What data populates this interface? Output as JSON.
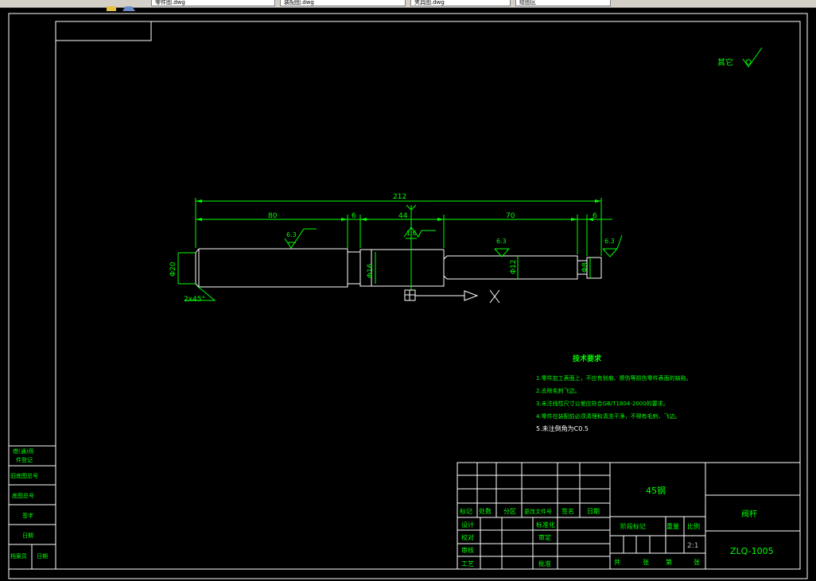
{
  "window": {
    "tabs": [
      {
        "label": "零件图.dwg"
      },
      {
        "label": "装配图.dwg"
      },
      {
        "label": "夹具图.dwg"
      },
      {
        "label": "绘图区"
      }
    ]
  },
  "colors": {
    "background": "#000000",
    "frame": "#ffffff",
    "geometry": "#ffffff",
    "dimension": "#00ff00",
    "text": "#00ff00",
    "ucs": "#ffffff"
  },
  "drawing": {
    "roughness_other": {
      "label": "其它",
      "symbol": "roughness-check-icon"
    },
    "dims": {
      "overall": "212",
      "d80": "80",
      "d6a": "6",
      "d44": "44",
      "d70": "70",
      "d6b": "6",
      "dia20": "Φ20",
      "dia16": "Φ16",
      "dia12": "Φ12",
      "dia8": "Φ8",
      "chamfer": "2x45°"
    },
    "roughness_values": [
      "6.3",
      "1.6",
      "6.3",
      "6.3"
    ],
    "tech_req": {
      "title": "技术要求",
      "items": [
        "1.零件加工表面上，不应有划痕、擦伤等损伤零件表面的缺陷。",
        "2.去除毛刺飞边。",
        "3.未注线性尺寸公差应符合GB/T1804-2000的要求。",
        "4.零件在装配前必须清理和清洗干净，不得有毛刺、飞边。",
        "5.未注倒角为C0.5"
      ]
    }
  },
  "title_block": {
    "material": "45钢",
    "part_name": "阀杆",
    "drawing_no": "ZLQ-1005",
    "scale": "2:1",
    "row_labels": [
      "标记",
      "处数",
      "分区",
      "更改文件号",
      "签名",
      "日期"
    ],
    "sign_rows": [
      {
        "left": "设计",
        "mid": "标准化"
      },
      {
        "left": "校对",
        "mid": "审定"
      },
      {
        "left": "审核",
        "mid": ""
      },
      {
        "left": "工艺",
        "mid": "批准"
      }
    ],
    "stage_label": "阶段标记",
    "weight_label": "重量",
    "scale_label": "比例",
    "sheet_text": [
      "共",
      "张",
      "第",
      "张"
    ]
  },
  "side_block": {
    "rows": [
      "借(通)用",
      "件登记",
      "旧底图总号",
      "底图总号",
      "签字",
      "日期"
    ],
    "bottom": [
      "档案员",
      "日期"
    ]
  }
}
